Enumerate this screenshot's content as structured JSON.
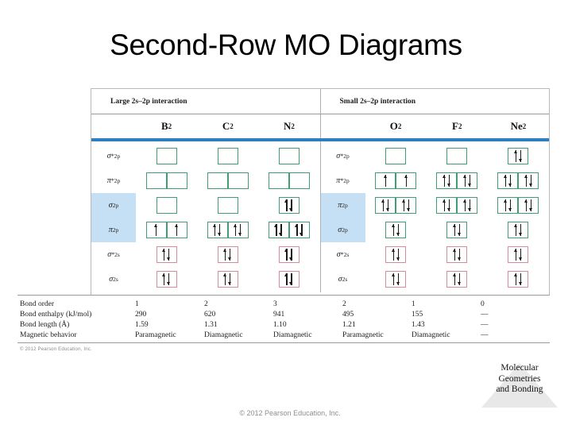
{
  "slide": {
    "title": "Second-Row MO Diagrams",
    "footer_copyright": "© 2012 Pearson Education, Inc.",
    "figure_copyright": "© 2012 Pearson Education, Inc.",
    "chapter_line1": "Molecular",
    "chapter_line2": "Geometries",
    "chapter_line3": "and Bonding"
  },
  "colors": {
    "divider_blue": "#2e7fc1",
    "highlight_blue": "#c5e0f5",
    "box_2p_green": "#3f9e74",
    "box_2s_pink": "#d98b99"
  },
  "figure": {
    "group_headers": [
      "Large 2s–2p interaction",
      "Small 2s–2p interaction"
    ],
    "left_half": {
      "orbital_labels": [
        {
          "text": "σ*2p",
          "base": "σ",
          "sup": "*",
          "sub": "2p",
          "highlight": false
        },
        {
          "text": "π*2p",
          "base": "π",
          "sup": "*",
          "sub": "2p",
          "highlight": false
        },
        {
          "text": "σ2p",
          "base": "σ",
          "sup": "",
          "sub": "2p",
          "highlight": true
        },
        {
          "text": "π2p",
          "base": "π",
          "sup": "",
          "sub": "2p",
          "highlight": true
        },
        {
          "text": "σ*2s",
          "base": "σ",
          "sup": "*",
          "sub": "2s",
          "highlight": false
        },
        {
          "text": "σ2s",
          "base": "σ",
          "sup": "",
          "sub": "2s",
          "highlight": false
        }
      ],
      "molecules": [
        {
          "name": "B2",
          "symbol": "B",
          "subscript": "2",
          "rows": [
            {
              "boxes": 1,
              "type": "2p",
              "electrons": [
                []
              ]
            },
            {
              "boxes": 2,
              "type": "2p",
              "electrons": [
                [],
                []
              ]
            },
            {
              "boxes": 1,
              "type": "2p",
              "electrons": [
                []
              ]
            },
            {
              "boxes": 2,
              "type": "2p",
              "electrons": [
                [
                  "up"
                ],
                [
                  "up"
                ]
              ]
            },
            {
              "boxes": 1,
              "type": "2s",
              "electrons": [
                [
                  "up",
                  "down"
                ]
              ]
            },
            {
              "boxes": 1,
              "type": "2s",
              "electrons": [
                [
                  "up",
                  "down"
                ]
              ]
            }
          ]
        },
        {
          "name": "C2",
          "symbol": "C",
          "subscript": "2",
          "rows": [
            {
              "boxes": 1,
              "type": "2p",
              "electrons": [
                []
              ]
            },
            {
              "boxes": 2,
              "type": "2p",
              "electrons": [
                [],
                []
              ]
            },
            {
              "boxes": 1,
              "type": "2p",
              "electrons": [
                []
              ]
            },
            {
              "boxes": 2,
              "type": "2p",
              "electrons": [
                [
                  "up",
                  "down"
                ],
                [
                  "up",
                  "down"
                ]
              ]
            },
            {
              "boxes": 1,
              "type": "2s",
              "electrons": [
                [
                  "up",
                  "down"
                ]
              ]
            },
            {
              "boxes": 1,
              "type": "2s",
              "electrons": [
                [
                  "up",
                  "down"
                ]
              ]
            }
          ]
        },
        {
          "name": "N2",
          "symbol": "N",
          "subscript": "2",
          "rows": [
            {
              "boxes": 1,
              "type": "2p",
              "electrons": [
                []
              ]
            },
            {
              "boxes": 2,
              "type": "2p",
              "electrons": [
                [],
                []
              ]
            },
            {
              "boxes": 1,
              "type": "2p",
              "electrons": [
                [
                  "up",
                  "down"
                ]
              ]
            },
            {
              "boxes": 2,
              "type": "2p",
              "electrons": [
                [
                  "up",
                  "down"
                ],
                [
                  "up",
                  "down"
                ]
              ]
            },
            {
              "boxes": 1,
              "type": "2s",
              "electrons": [
                [
                  "up",
                  "down"
                ]
              ]
            },
            {
              "boxes": 1,
              "type": "2s",
              "electrons": [
                [
                  "up",
                  "down"
                ]
              ]
            }
          ]
        }
      ]
    },
    "right_half": {
      "orbital_labels": [
        {
          "text": "σ*2p",
          "base": "σ",
          "sup": "*",
          "sub": "2p",
          "highlight": false
        },
        {
          "text": "π*2p",
          "base": "π",
          "sup": "*",
          "sub": "2p",
          "highlight": false
        },
        {
          "text": "π2p",
          "base": "π",
          "sup": "",
          "sub": "2p",
          "highlight": true
        },
        {
          "text": "σ2p",
          "base": "σ",
          "sup": "",
          "sub": "2p",
          "highlight": true
        },
        {
          "text": "σ*2s",
          "base": "σ",
          "sup": "*",
          "sub": "2s",
          "highlight": false
        },
        {
          "text": "σ2s",
          "base": "σ",
          "sup": "",
          "sub": "2s",
          "highlight": false
        }
      ],
      "molecules": [
        {
          "name": "O2",
          "symbol": "O",
          "subscript": "2",
          "rows": [
            {
              "boxes": 1,
              "type": "2p",
              "electrons": [
                []
              ]
            },
            {
              "boxes": 2,
              "type": "2p",
              "electrons": [
                [
                  "up"
                ],
                [
                  "up"
                ]
              ]
            },
            {
              "boxes": 2,
              "type": "2p",
              "electrons": [
                [
                  "up",
                  "down"
                ],
                [
                  "up",
                  "down"
                ]
              ]
            },
            {
              "boxes": 1,
              "type": "2p",
              "electrons": [
                [
                  "up",
                  "down"
                ]
              ]
            },
            {
              "boxes": 1,
              "type": "2s",
              "electrons": [
                [
                  "up",
                  "down"
                ]
              ]
            },
            {
              "boxes": 1,
              "type": "2s",
              "electrons": [
                [
                  "up",
                  "down"
                ]
              ]
            }
          ]
        },
        {
          "name": "F2",
          "symbol": "F",
          "subscript": "2",
          "rows": [
            {
              "boxes": 1,
              "type": "2p",
              "electrons": [
                []
              ]
            },
            {
              "boxes": 2,
              "type": "2p",
              "electrons": [
                [
                  "up",
                  "down"
                ],
                [
                  "up",
                  "down"
                ]
              ]
            },
            {
              "boxes": 2,
              "type": "2p",
              "electrons": [
                [
                  "up",
                  "down"
                ],
                [
                  "up",
                  "down"
                ]
              ]
            },
            {
              "boxes": 1,
              "type": "2p",
              "electrons": [
                [
                  "up",
                  "down"
                ]
              ]
            },
            {
              "boxes": 1,
              "type": "2s",
              "electrons": [
                [
                  "up",
                  "down"
                ]
              ]
            },
            {
              "boxes": 1,
              "type": "2s",
              "electrons": [
                [
                  "up",
                  "down"
                ]
              ]
            }
          ]
        },
        {
          "name": "Ne2",
          "symbol": "Ne",
          "subscript": "2",
          "rows": [
            {
              "boxes": 1,
              "type": "2p",
              "electrons": [
                [
                  "up",
                  "down"
                ]
              ]
            },
            {
              "boxes": 2,
              "type": "2p",
              "electrons": [
                [
                  "up",
                  "down"
                ],
                [
                  "up",
                  "down"
                ]
              ]
            },
            {
              "boxes": 2,
              "type": "2p",
              "electrons": [
                [
                  "up",
                  "down"
                ],
                [
                  "up",
                  "down"
                ]
              ]
            },
            {
              "boxes": 1,
              "type": "2p",
              "electrons": [
                [
                  "up",
                  "down"
                ]
              ]
            },
            {
              "boxes": 1,
              "type": "2s",
              "electrons": [
                [
                  "up",
                  "down"
                ]
              ]
            },
            {
              "boxes": 1,
              "type": "2s",
              "electrons": [
                [
                  "up",
                  "down"
                ]
              ]
            }
          ]
        }
      ]
    }
  },
  "data_table": {
    "row_labels": [
      "Bond order",
      "Bond enthalpy (kJ/mol)",
      "Bond length (Å)",
      "Magnetic behavior"
    ],
    "columns": [
      "B2",
      "C2",
      "N2",
      "O2",
      "F2",
      "Ne2"
    ],
    "rows": [
      {
        "label": "Bond order",
        "values": [
          "1",
          "2",
          "3",
          "2",
          "1",
          "0"
        ],
        "bold": false
      },
      {
        "label": "Bond enthalpy (kJ/mol)",
        "values": [
          "290",
          "620",
          "941",
          "495",
          "155",
          "—"
        ],
        "bold": false
      },
      {
        "label": "Bond length (Å)",
        "values": [
          "1.59",
          "1.31",
          "1.10",
          "1.21",
          "1.43",
          "—"
        ],
        "bold": false
      },
      {
        "label": "Magnetic behavior",
        "values": [
          "Paramagnetic",
          "Diamagnetic",
          "Diamagnetic",
          "Paramagnetic",
          "Diamagnetic",
          "—"
        ],
        "bold": false
      }
    ]
  }
}
